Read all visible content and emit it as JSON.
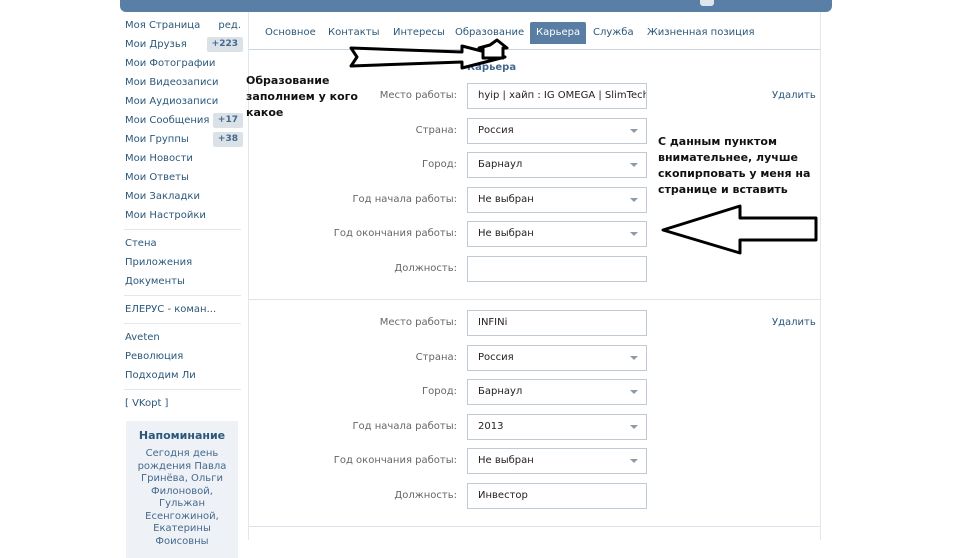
{
  "sidebar": {
    "items": [
      {
        "label": "Моя Страница",
        "extra": "ред."
      },
      {
        "label": "Мои Друзья",
        "count": "+223"
      },
      {
        "label": "Мои Фотографии"
      },
      {
        "label": "Мои Видеозаписи"
      },
      {
        "label": "Мои Аудиозаписи"
      },
      {
        "label": "Мои Сообщения",
        "count": "+17"
      },
      {
        "label": "Мои Группы",
        "count": "+38"
      },
      {
        "label": "Мои Новости"
      },
      {
        "label": "Мои Ответы"
      },
      {
        "label": "Мои Закладки"
      },
      {
        "label": "Мои Настройки"
      }
    ],
    "apps": [
      "Стена",
      "Приложения",
      "Документы"
    ],
    "groups": [
      "ЕЛЕРУС - коман..."
    ],
    "more": [
      "Aveten",
      "Революция",
      "Подходим Ли"
    ],
    "vkopt": "[ VKopt ]",
    "reminder": {
      "title": "Напоминание",
      "text": "Сегодня день рождения Павла Гринёва, Ольги Филоновой, Гульжан Есенгожиной, Екатерины Фоисовны"
    }
  },
  "tabs": [
    "Основное",
    "Контакты",
    "Интересы",
    "Образование",
    "Карьера",
    "Служба",
    "Жизненная позиция"
  ],
  "active_tab": "Карьера",
  "section_title": "Карьера",
  "labels": {
    "workplace": "Место работы:",
    "country": "Страна:",
    "city": "Город:",
    "start_year": "Год начала работы:",
    "end_year": "Год окончания работы:",
    "position": "Должность:",
    "delete": "Удалить"
  },
  "jobs": [
    {
      "workplace": "hyip | хайп : IG OMEGA | SlimTech |...",
      "country": "Россия",
      "city": "Барнаул",
      "start_year": "Не выбран",
      "end_year": "Не выбран",
      "position": ""
    },
    {
      "workplace": "INFINi",
      "country": "Россия",
      "city": "Барнаул",
      "start_year": "2013",
      "end_year": "Не выбран",
      "position": "Инвестор"
    }
  ],
  "annotations": {
    "left": "Образование заполнием у кого какое",
    "right": "С данным пунктом внимательнее, лучше скопирповать у меня на странице и вставить"
  }
}
